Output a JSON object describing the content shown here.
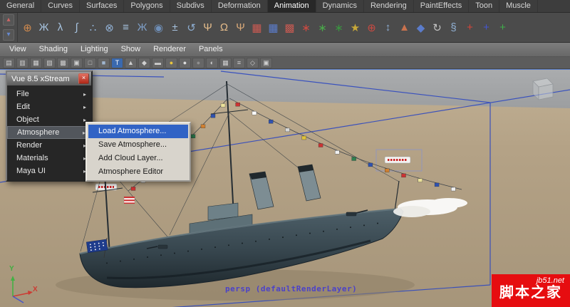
{
  "colors": {
    "accent_blue": "#2f49c0",
    "menu_highlight_blue": "#3163c5",
    "watermark_red": "#e60d10",
    "ground_sand": "#b4a286",
    "sky_gray": "#a4a6a8"
  },
  "menubar": {
    "tabs": [
      {
        "label": "General"
      },
      {
        "label": "Curves"
      },
      {
        "label": "Surfaces"
      },
      {
        "label": "Polygons"
      },
      {
        "label": "Subdivs"
      },
      {
        "label": "Deformation"
      },
      {
        "label": "Animation",
        "active": true
      },
      {
        "label": "Dynamics"
      },
      {
        "label": "Rendering"
      },
      {
        "label": "PaintEffects"
      },
      {
        "label": "Toon"
      },
      {
        "label": "Muscle"
      }
    ]
  },
  "shelf": {
    "side_icons": [
      {
        "name": "shelf-tab-up-icon",
        "glyph": "▴",
        "color": "#cc6666"
      },
      {
        "name": "shelf-tab-down-icon",
        "glyph": "▾",
        "color": "#6688cc"
      }
    ],
    "icons": [
      {
        "name": "snap-magnet-icon",
        "glyph": "⊕",
        "color": "#d08a4e"
      },
      {
        "name": "joint-tool-icon",
        "glyph": "Ж",
        "color": "#a6c2de"
      },
      {
        "name": "ik-handle-icon",
        "glyph": "λ",
        "color": "#a6c2de"
      },
      {
        "name": "ik-spline-icon",
        "glyph": "∫",
        "color": "#a6c2de"
      },
      {
        "name": "joint-chain-icon",
        "glyph": "∴",
        "color": "#92b2d6"
      },
      {
        "name": "constraint-icon",
        "glyph": "⊗",
        "color": "#92b2d6"
      },
      {
        "name": "set-key-icon",
        "glyph": "≡",
        "color": "#a6c2de"
      },
      {
        "name": "skeleton-icon",
        "glyph": "Ж",
        "color": "#7e9ec6"
      },
      {
        "name": "cluster-icon",
        "glyph": "◉",
        "color": "#6f8fb8"
      },
      {
        "name": "lattice-icon",
        "glyph": "±",
        "color": "#a6c2de"
      },
      {
        "name": "motion-path-icon",
        "glyph": "↺",
        "color": "#8cacd0"
      },
      {
        "name": "character-icon",
        "glyph": "Ψ",
        "color": "#e2ba8a"
      },
      {
        "name": "character-pose-icon",
        "glyph": "Ω",
        "color": "#e2ba8a"
      },
      {
        "name": "skin-bind-icon",
        "glyph": "Ψ",
        "color": "#d8a878"
      },
      {
        "name": "red-grid-icon",
        "glyph": "▦",
        "color": "#cc5a52"
      },
      {
        "name": "blue-grid-icon",
        "glyph": "▦",
        "color": "#5b7ccb"
      },
      {
        "name": "hatch-grid-icon",
        "glyph": "▩",
        "color": "#c65a52"
      },
      {
        "name": "paint-brush-icon",
        "glyph": "∗",
        "color": "#cc4a42"
      },
      {
        "name": "snowflake-icon",
        "glyph": "∗",
        "color": "#4aa84a"
      },
      {
        "name": "star-burst-icon",
        "glyph": "∗",
        "color": "#3a9440"
      },
      {
        "name": "star-icon",
        "glyph": "★",
        "color": "#c8a838"
      },
      {
        "name": "target-icon",
        "glyph": "⊕",
        "color": "#c84a42"
      },
      {
        "name": "swap-icon",
        "glyph": "↕",
        "color": "#8cacd0"
      },
      {
        "name": "cone-icon",
        "glyph": "▲",
        "color": "#c8724e"
      },
      {
        "name": "diamond-icon",
        "glyph": "◆",
        "color": "#5b7ccb"
      },
      {
        "name": "rotate-icon",
        "glyph": "↻",
        "color": "#c2c2c2"
      },
      {
        "name": "section-icon",
        "glyph": "§",
        "color": "#92b2d6"
      },
      {
        "name": "axis-red-icon",
        "glyph": "+",
        "color": "#d84438"
      },
      {
        "name": "axis-blue-icon",
        "glyph": "+",
        "color": "#4456d0"
      },
      {
        "name": "axis-green-icon",
        "glyph": "+",
        "color": "#3fae4a"
      }
    ]
  },
  "viewport_menubar": {
    "items": [
      "View",
      "Shading",
      "Lighting",
      "Show",
      "Renderer",
      "Panels"
    ]
  },
  "viewport_toolbar": {
    "icons": [
      {
        "glyph": "▤",
        "color": "#cfcfcf"
      },
      {
        "glyph": "▥",
        "color": "#cfcfcf"
      },
      {
        "glyph": "▦",
        "color": "#cfcfcf"
      },
      {
        "glyph": "▧",
        "color": "#cfcfcf"
      },
      {
        "glyph": "▩",
        "color": "#cfcfcf"
      },
      {
        "glyph": "▣",
        "color": "#cfcfcf"
      },
      {
        "glyph": "□",
        "color": "#cfcfcf"
      },
      {
        "glyph": "■",
        "color": "#9fb6cf"
      },
      {
        "glyph": "T",
        "color": "#ffffff",
        "bg": "#3a69ae"
      },
      {
        "glyph": "▲",
        "color": "#cfcfcf"
      },
      {
        "glyph": "◆",
        "color": "#cfcfcf"
      },
      {
        "glyph": "▬",
        "color": "#cfcfcf"
      },
      {
        "glyph": "●",
        "color": "#e9c63c"
      },
      {
        "glyph": "●",
        "color": "#dddddd"
      },
      {
        "glyph": "●",
        "color": "#8f8f8f"
      },
      {
        "glyph": "◐",
        "color": "#cfcfcf"
      },
      {
        "glyph": "▦",
        "color": "#cfcfcf"
      },
      {
        "glyph": "≡",
        "color": "#cfcfcf"
      },
      {
        "glyph": "◇",
        "color": "#cfcfcf"
      },
      {
        "glyph": "▣",
        "color": "#cfcfcf"
      }
    ]
  },
  "vue_panel": {
    "title": "Vue 8.5 xStream",
    "close_icon": "×",
    "items": [
      {
        "label": "File"
      },
      {
        "label": "Edit"
      },
      {
        "label": "Object"
      },
      {
        "label": "Atmosphere",
        "highlighted": true
      },
      {
        "label": "Render"
      },
      {
        "label": "Materials"
      },
      {
        "label": "Maya UI"
      }
    ]
  },
  "atmosphere_submenu": {
    "items": [
      {
        "label": "Load Atmosphere...",
        "highlighted": true
      },
      {
        "label": "Save Atmosphere..."
      },
      {
        "label": "Add Cloud Layer..."
      },
      {
        "label": "Atmosphere Editor"
      }
    ]
  },
  "viewport": {
    "camera_label": "persp (defaultRenderLayer)",
    "axis_labels": {
      "x": "X",
      "y": "Y"
    }
  },
  "scene": {
    "flag_string_1": {
      "colors": [
        "#cc3333",
        "#f0f0f0",
        "#2f52b0",
        "#e0c23a",
        "#cc3333",
        "#f6f6f4",
        "#2f8050",
        "#d08030",
        "#2f52b0",
        "#ece29a"
      ]
    },
    "flag_string_2": {
      "colors": [
        "#cc3333",
        "#ffffff",
        "#2f52b0",
        "#d8d8d8",
        "#e0c23a",
        "#cc3333",
        "#f0f0f0",
        "#2f8050",
        "#2f52b0",
        "#d08030",
        "#cc3333",
        "#ece29a",
        "#2f52b0",
        "#f0f0f0"
      ]
    }
  },
  "watermark": {
    "site": "jb51.net",
    "name": "脚本之家"
  }
}
